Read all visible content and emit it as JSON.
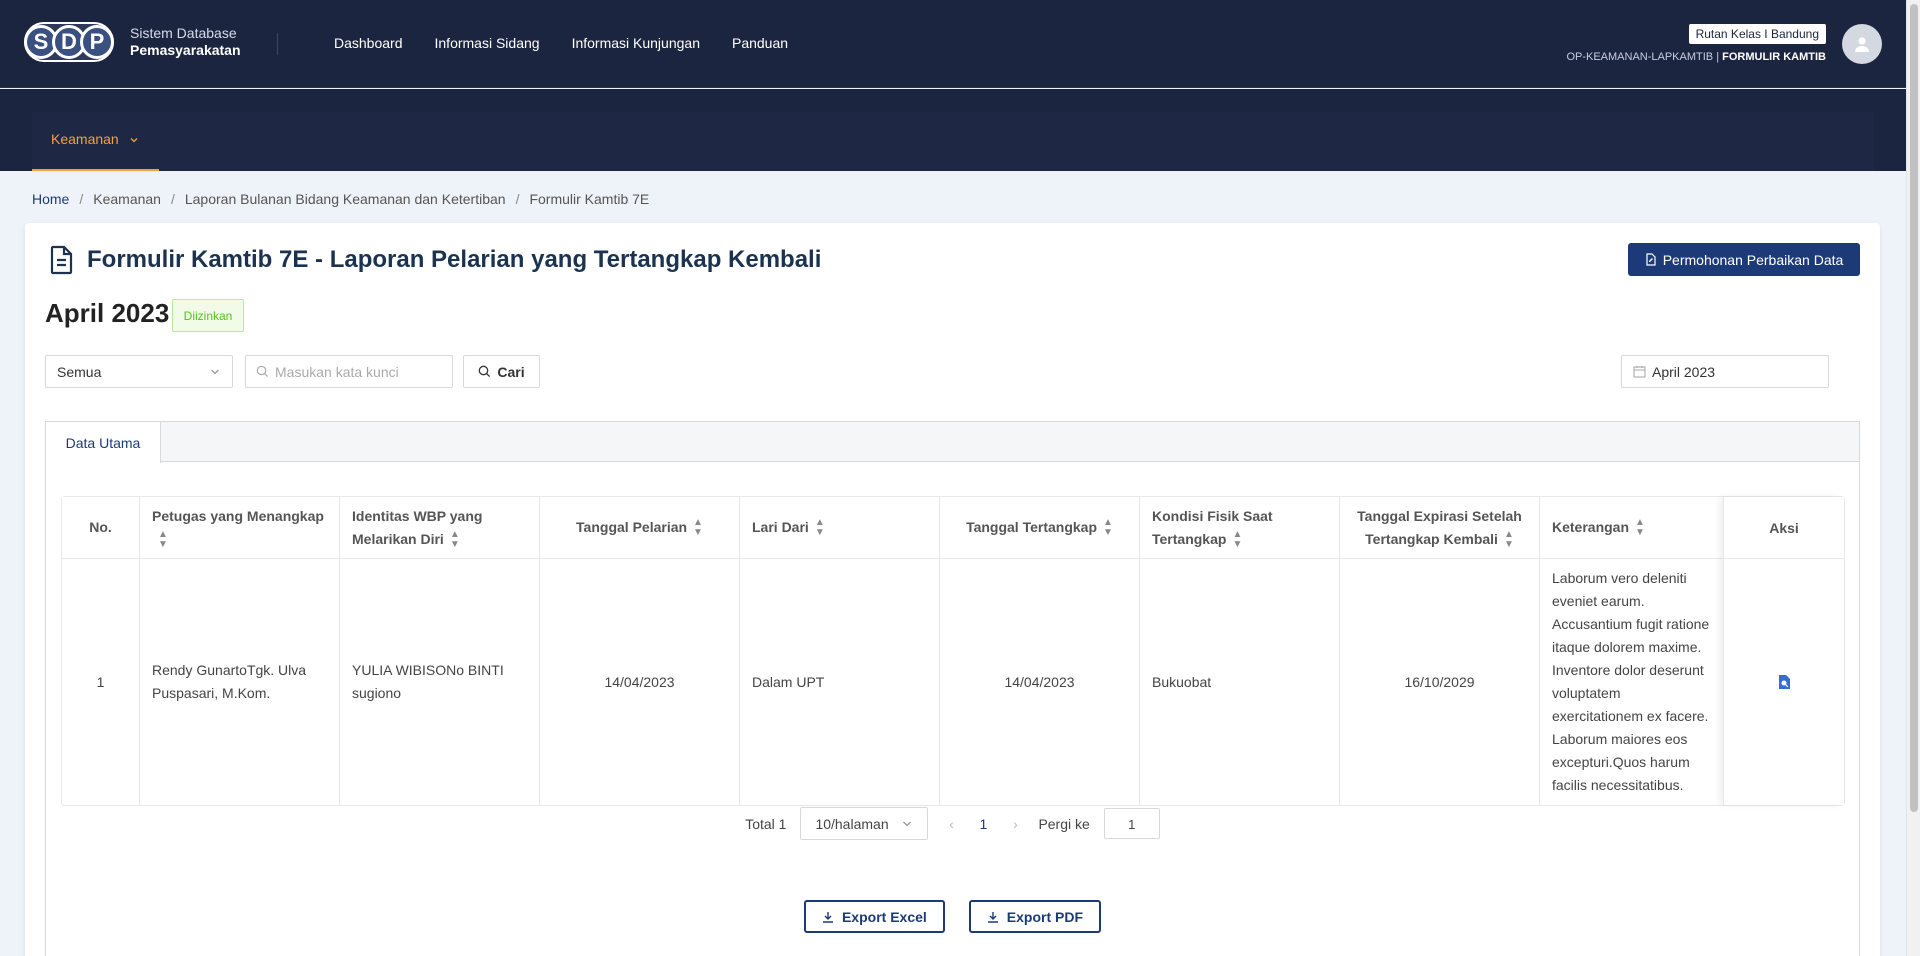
{
  "header": {
    "logo_letters": [
      "S",
      "D",
      "P"
    ],
    "logo_line1": "Sistem Database",
    "logo_line2": "Pemasyarakatan",
    "nav": [
      "Dashboard",
      "Informasi Sidang",
      "Informasi Kunjungan",
      "Panduan"
    ],
    "org_badge": "Rutan Kelas I Bandung",
    "role_prefix": "OP-KEAMANAN-LAPKAMTIB",
    "role_separator": " | ",
    "role_section": "FORMULIR KAMTIB"
  },
  "subnav": {
    "active_item": "Keamanan"
  },
  "breadcrumb": [
    "Home",
    "Keamanan",
    "Laporan Bulanan Bidang Keamanan dan Ketertiban",
    "Formulir Kamtib 7E"
  ],
  "page": {
    "title": "Formulir Kamtib 7E - Laporan Pelarian yang Tertangkap Kembali",
    "action_button": "Permohonan Perbaikan Data",
    "period": "April 2023",
    "status": "Diizinkan"
  },
  "filters": {
    "select_value": "Semua",
    "search_placeholder": "Masukan kata kunci",
    "search_button": "Cari",
    "date_value": "April 2023"
  },
  "tabs": [
    "Data Utama"
  ],
  "table": {
    "headers": [
      "No.",
      "Petugas yang Menangkap",
      "Identitas WBP yang Melarikan Diri",
      "Tanggal Pelarian",
      "Lari Dari",
      "Tanggal Tertangkap",
      "Kondisi Fisik Saat Tertangkap",
      "Tanggal Expirasi Setelah Tertangkap Kembali",
      "Keterangan",
      "Aksi"
    ],
    "rows": [
      {
        "no": "1",
        "petugas": "Rendy GunartoTgk. Ulva Puspasari, M.Kom.",
        "identitas": "YULIA WIBISONo BINTI sugiono",
        "tanggal_pelarian": "14/04/2023",
        "lari_dari": "Dalam UPT",
        "tanggal_tertangkap": "14/04/2023",
        "kondisi_fisik": "Bukuobat",
        "tanggal_expirasi": "16/10/2029",
        "keterangan": "Laborum vero deleniti eveniet earum. Accusantium fugit ratione itaque dolorem maxime. Inventore dolor deserunt voluptatem exercitationem ex facere. Laborum maiores eos excepturi.Quos harum facilis necessitatibus. Cum neque doloremque solutaa iusto. Dolor"
      }
    ]
  },
  "pagination": {
    "total_label": "Total 1",
    "page_size": "10/halaman",
    "current_page": "1",
    "goto_label": "Pergi ke",
    "goto_value": "1"
  },
  "export": {
    "excel": "Export Excel",
    "pdf": "Export PDF"
  },
  "colors": {
    "navy": "#1c2540",
    "primary": "#1d3a78",
    "accent": "#f5a040",
    "success": "#52c41a"
  }
}
